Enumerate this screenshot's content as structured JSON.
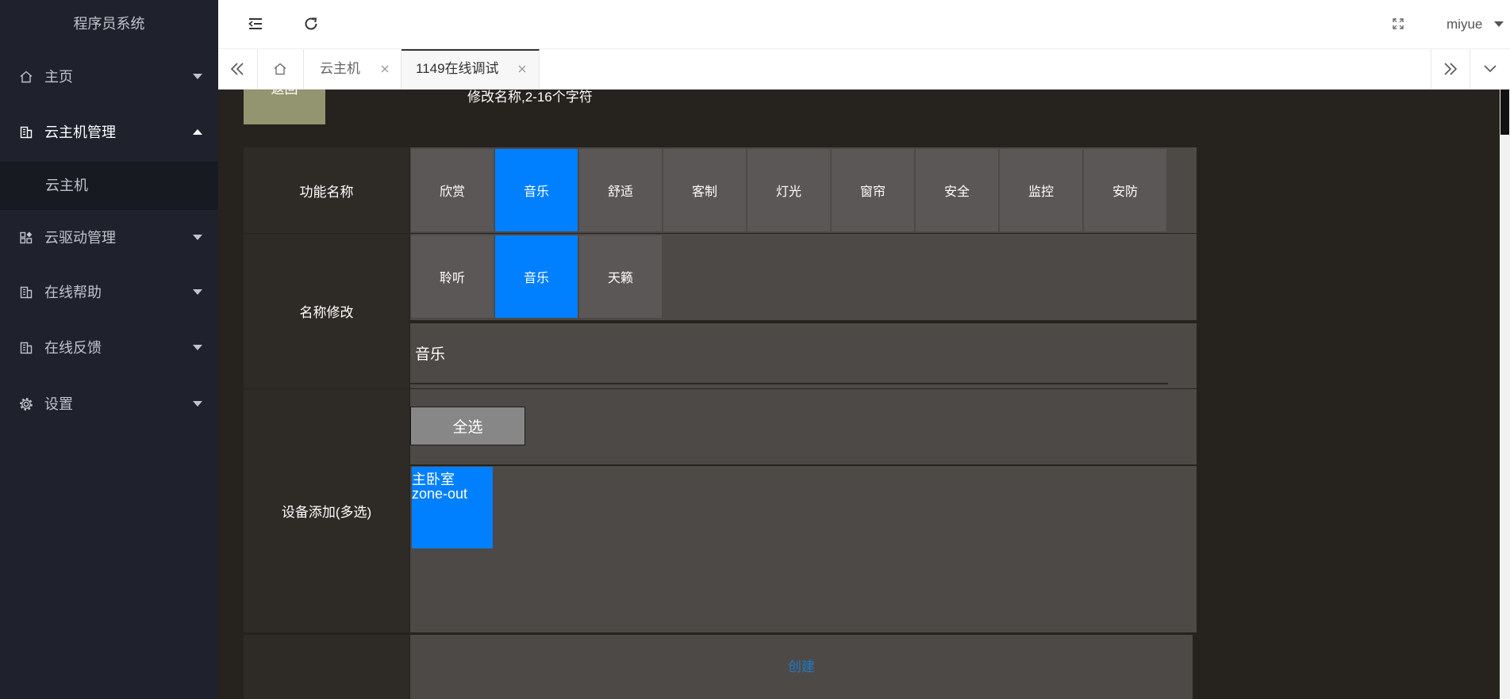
{
  "sidebar": {
    "title": "程序员系统",
    "items": [
      {
        "label": "主页",
        "icon": "home-icon",
        "expanded": false
      },
      {
        "label": "云主机管理",
        "icon": "building-icon",
        "expanded": true,
        "children": [
          {
            "label": "云主机"
          }
        ]
      },
      {
        "label": "云驱动管理",
        "icon": "grid-icon",
        "expanded": false
      },
      {
        "label": "在线帮助",
        "icon": "building-icon",
        "expanded": false
      },
      {
        "label": "在线反馈",
        "icon": "building-icon",
        "expanded": false
      },
      {
        "label": "设置",
        "icon": "gear-icon",
        "expanded": false
      }
    ]
  },
  "header": {
    "icons": [
      "indent-icon",
      "refresh-icon",
      "fullscreen-icon"
    ],
    "user": "miyue"
  },
  "tabs": {
    "items": [
      {
        "label": "云主机",
        "active": false
      },
      {
        "label": "1149在线调试",
        "active": true
      }
    ]
  },
  "form": {
    "back_label": "返回",
    "name_hint": "修改名称,2-16个字符",
    "function_label": "功能名称",
    "functions": [
      {
        "label": "欣赏",
        "selected": false
      },
      {
        "label": "音乐",
        "selected": true
      },
      {
        "label": "舒适",
        "selected": false
      },
      {
        "label": "客制",
        "selected": false
      },
      {
        "label": "灯光",
        "selected": false
      },
      {
        "label": "窗帘",
        "selected": false
      },
      {
        "label": "安全",
        "selected": false
      },
      {
        "label": "监控",
        "selected": false
      },
      {
        "label": "安防",
        "selected": false
      }
    ],
    "rename_label": "名称修改",
    "name_options": [
      {
        "label": "聆听",
        "selected": false
      },
      {
        "label": "音乐",
        "selected": true
      },
      {
        "label": "天籁",
        "selected": false
      }
    ],
    "name_value": "音乐",
    "device_label": "设备添加(多选)",
    "select_all_label": "全选",
    "devices": [
      {
        "name": "主卧室",
        "zone": "zone-out",
        "selected": true
      }
    ],
    "create_label": "创建"
  },
  "colors": {
    "accent": "#0080ff",
    "sidebar_bg": "#1f222c",
    "content_bg": "#26221e",
    "cell_bg": "#4d4946",
    "button_bg": "#5b5756",
    "back_button_bg": "#939470",
    "link": "#1f7ac7"
  }
}
